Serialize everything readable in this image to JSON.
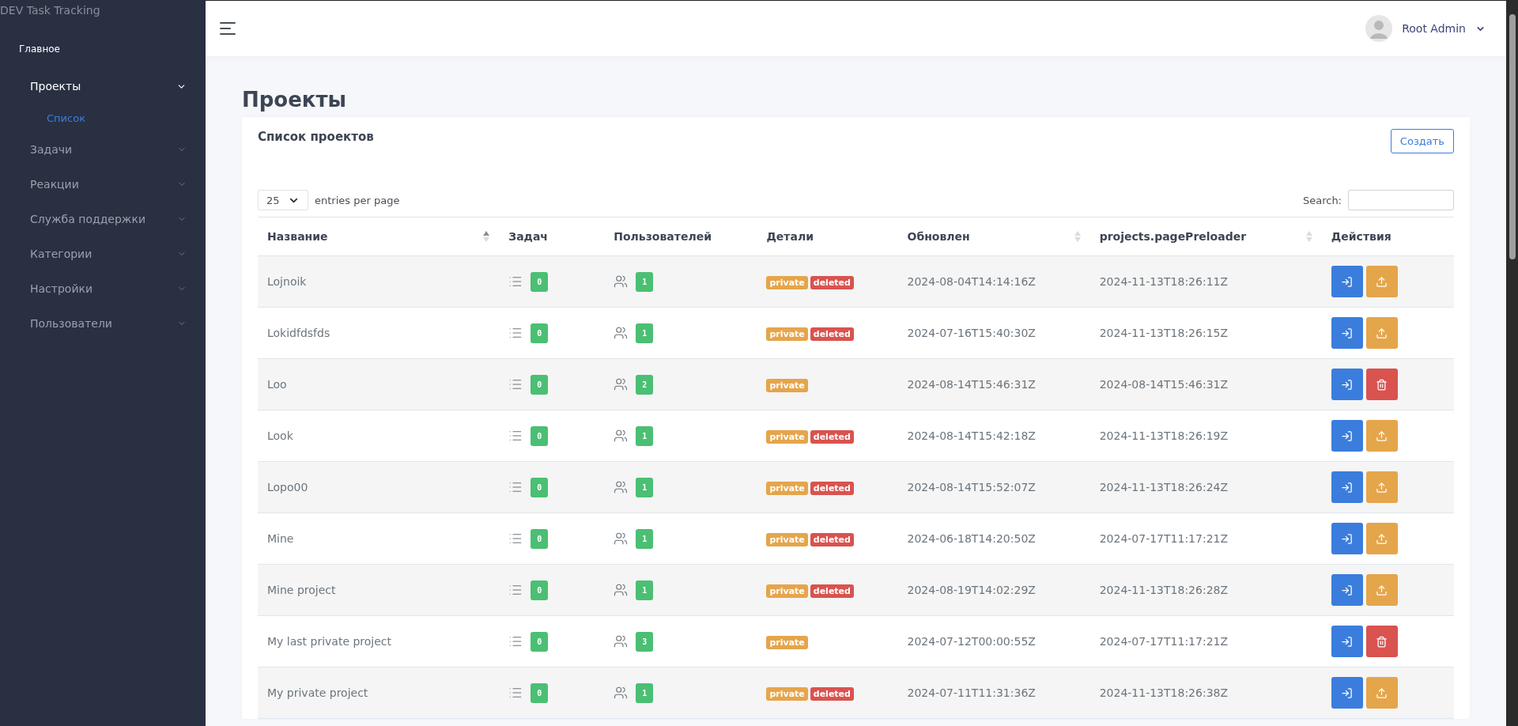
{
  "brand": "DEV Task Tracking",
  "sidebar": {
    "section": "Главное",
    "items": [
      {
        "label": "Проекты",
        "expanded": true,
        "children": [
          {
            "label": "Список",
            "selected": true
          }
        ]
      },
      {
        "label": "Задачи",
        "expanded": false
      },
      {
        "label": "Реакции",
        "expanded": false
      },
      {
        "label": "Служба поддержки",
        "expanded": false
      },
      {
        "label": "Категории",
        "expanded": false
      },
      {
        "label": "Настройки",
        "expanded": false
      },
      {
        "label": "Пользователи",
        "expanded": false
      }
    ]
  },
  "user": {
    "name": "Root Admin"
  },
  "page_title": "Проекты",
  "card": {
    "title": "Список проектов",
    "create_button": "Создать",
    "page_size": "25",
    "page_size_label": "entries per page",
    "search_label": "Search:"
  },
  "table": {
    "columns": [
      {
        "label": "Название",
        "sortable": true,
        "sorted": true
      },
      {
        "label": "Задач"
      },
      {
        "label": "Пользователей"
      },
      {
        "label": "Детали"
      },
      {
        "label": "Обновлен",
        "sortable": true,
        "sorted": false
      },
      {
        "label": "projects.pagePreloader",
        "sortable": true,
        "sorted": false
      },
      {
        "label": "Действия"
      }
    ],
    "rows": [
      {
        "kind": "deleted",
        "name": "Lojnoik",
        "tasks": "0",
        "users": "1",
        "tags": [
          {
            "text": "private",
            "kind": "private"
          },
          {
            "text": "deleted",
            "kind": "deleted"
          }
        ],
        "updated": "2024-08-04T14:14:16Z",
        "preloader": "2024-11-13T18:26:11Z"
      },
      {
        "kind": "deleted",
        "name": "Lokidfdsfds",
        "tasks": "0",
        "users": "1",
        "tags": [
          {
            "text": "private",
            "kind": "private"
          },
          {
            "text": "deleted",
            "kind": "deleted"
          }
        ],
        "updated": "2024-07-16T15:40:30Z",
        "preloader": "2024-11-13T18:26:15Z"
      },
      {
        "kind": "active",
        "name": "Loo",
        "tasks": "0",
        "users": "2",
        "tags": [
          {
            "text": "private",
            "kind": "private"
          }
        ],
        "updated": "2024-08-14T15:46:31Z",
        "preloader": "2024-08-14T15:46:31Z"
      },
      {
        "kind": "deleted",
        "name": "Look",
        "tasks": "0",
        "users": "1",
        "tags": [
          {
            "text": "private",
            "kind": "private"
          },
          {
            "text": "deleted",
            "kind": "deleted"
          }
        ],
        "updated": "2024-08-14T15:42:18Z",
        "preloader": "2024-11-13T18:26:19Z"
      },
      {
        "kind": "deleted",
        "name": "Lopo00",
        "tasks": "0",
        "users": "1",
        "tags": [
          {
            "text": "private",
            "kind": "private"
          },
          {
            "text": "deleted",
            "kind": "deleted"
          }
        ],
        "updated": "2024-08-14T15:52:07Z",
        "preloader": "2024-11-13T18:26:24Z"
      },
      {
        "kind": "deleted",
        "name": "Mine",
        "tasks": "0",
        "users": "1",
        "tags": [
          {
            "text": "private",
            "kind": "private"
          },
          {
            "text": "deleted",
            "kind": "deleted"
          }
        ],
        "updated": "2024-06-18T14:20:50Z",
        "preloader": "2024-07-17T11:17:21Z"
      },
      {
        "kind": "deleted",
        "name": "Mine project",
        "tasks": "0",
        "users": "1",
        "tags": [
          {
            "text": "private",
            "kind": "private"
          },
          {
            "text": "deleted",
            "kind": "deleted"
          }
        ],
        "updated": "2024-08-19T14:02:29Z",
        "preloader": "2024-11-13T18:26:28Z"
      },
      {
        "kind": "active",
        "name": "My last private project",
        "tasks": "0",
        "users": "3",
        "tags": [
          {
            "text": "private",
            "kind": "private"
          }
        ],
        "updated": "2024-07-12T00:00:55Z",
        "preloader": "2024-07-17T11:17:21Z"
      },
      {
        "kind": "deleted",
        "name": "My private project",
        "tasks": "0",
        "users": "1",
        "tags": [
          {
            "text": "private",
            "kind": "private"
          },
          {
            "text": "deleted",
            "kind": "deleted"
          }
        ],
        "updated": "2024-07-11T11:31:36Z",
        "preloader": "2024-11-13T18:26:38Z"
      }
    ]
  }
}
